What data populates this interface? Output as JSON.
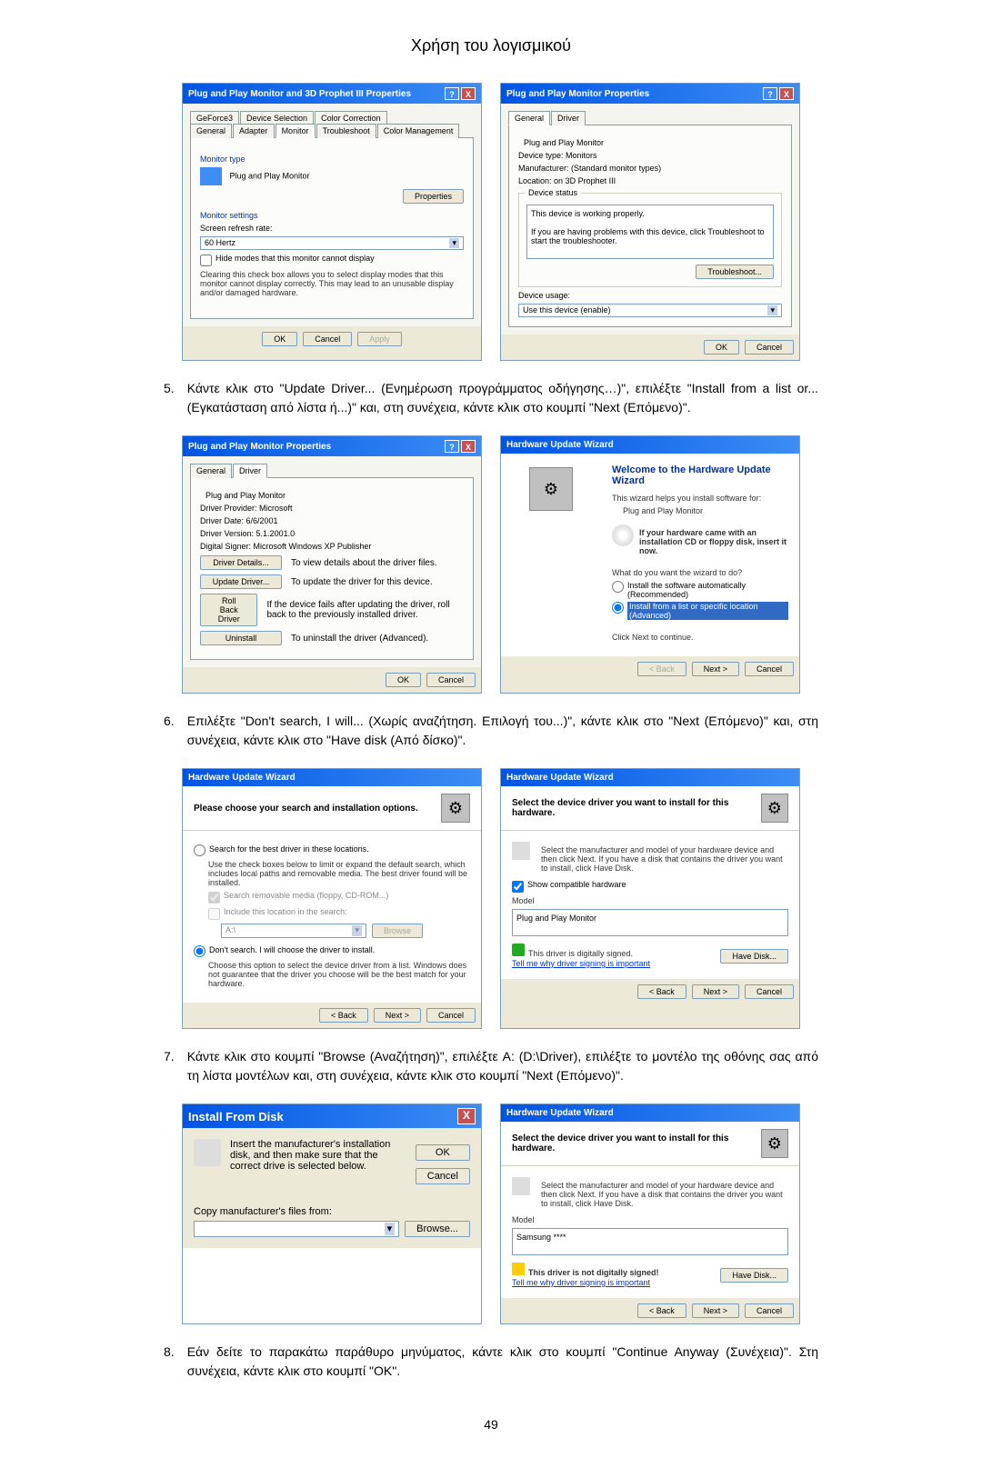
{
  "page_title": "Χρήση του λογισμικού",
  "page_number": "49",
  "steps": {
    "5": {
      "num": "5.",
      "text": "Κάντε κλικ στο \"Update Driver... (Ενημέρωση προγράμματος οδήγησης…)\", επιλέξτε \"Install from a list or...(Εγκατάσταση από λίστα ή...)\" και, στη συνέχεια, κάντε κλικ στο κουμπί \"Next (Επόμενο)\"."
    },
    "6": {
      "num": "6.",
      "text": "Επιλέξτε \"Don't search, I will... (Χωρίς αναζήτηση. Επιλογή του...)\", κάντε κλικ στο \"Next (Επόμενο)\" και, στη συνέχεια, κάντε κλικ στο \"Have disk (Από δίσκο)\"."
    },
    "7": {
      "num": "7.",
      "text": "Κάντε κλικ στο κουμπί \"Browse (Αναζήτηση)\", επιλέξτε A: (D:\\Driver), επιλέξτε το μοντέλο της οθόνης σας από τη λίστα μοντέλων και, στη συνέχεια, κάντε κλικ στο κουμπί \"Next (Επόμενο)\"."
    },
    "8": {
      "num": "8.",
      "text": "Εάν δείτε το παρακάτω παράθυρο μηνύματος, κάντε κλικ στο κουμπί \"Continue Anyway (Συνέχεια)\". Στη συνέχεια, κάντε κλικ στο κουμπί \"OK\"."
    }
  },
  "dlg1": {
    "title": "Plug and Play Monitor and 3D Prophet III Properties",
    "tabs": {
      "geforce": "GeForce3",
      "devsel": "Device Selection",
      "colorcorr": "Color Correction",
      "general": "General",
      "adapter": "Adapter",
      "monitor": "Monitor",
      "troubleshoot": "Troubleshoot",
      "colormgmt": "Color Management"
    },
    "monitor_type": "Monitor type",
    "pnp_monitor": "Plug and Play Monitor",
    "properties_btn": "Properties",
    "monitor_settings": "Monitor settings",
    "refresh_label": "Screen refresh rate:",
    "refresh_value": "60 Hertz",
    "hide_modes": "Hide modes that this monitor cannot display",
    "hide_modes_desc": "Clearing this check box allows you to select display modes that this monitor cannot display correctly. This may lead to an unusable display and/or damaged hardware.",
    "ok": "OK",
    "cancel": "Cancel",
    "apply": "Apply"
  },
  "dlg2": {
    "title": "Plug and Play Monitor Properties",
    "tabs": {
      "general": "General",
      "driver": "Driver"
    },
    "pnp_monitor": "Plug and Play Monitor",
    "device_type_label": "Device type:",
    "device_type": "Monitors",
    "manufacturer_label": "Manufacturer:",
    "manufacturer": "(Standard monitor types)",
    "location_label": "Location:",
    "location": "on 3D Prophet III",
    "device_status": "Device status",
    "status_text": "This device is working properly.",
    "status_help": "If you are having problems with this device, click Troubleshoot to start the troubleshooter.",
    "troubleshoot": "Troubleshoot...",
    "device_usage": "Device usage:",
    "usage_value": "Use this device (enable)",
    "ok": "OK",
    "cancel": "Cancel"
  },
  "dlg3": {
    "title": "Plug and Play Monitor Properties",
    "tabs": {
      "general": "General",
      "driver": "Driver"
    },
    "pnp_monitor": "Plug and Play Monitor",
    "provider_label": "Driver Provider:",
    "provider": "Microsoft",
    "date_label": "Driver Date:",
    "date": "6/6/2001",
    "version_label": "Driver Version:",
    "version": "5.1.2001.0",
    "signer_label": "Digital Signer:",
    "signer": "Microsoft Windows XP Publisher",
    "details_btn": "Driver Details...",
    "details_desc": "To view details about the driver files.",
    "update_btn": "Update Driver...",
    "update_desc": "To update the driver for this device.",
    "rollback_btn": "Roll Back Driver",
    "rollback_desc": "If the device fails after updating the driver, roll back to the previously installed driver.",
    "uninstall_btn": "Uninstall",
    "uninstall_desc": "To uninstall the driver (Advanced).",
    "ok": "OK",
    "cancel": "Cancel"
  },
  "dlg4": {
    "title": "Hardware Update Wizard",
    "heading": "Welcome to the Hardware Update Wizard",
    "intro": "This wizard helps you install software for:",
    "device": "Plug and Play Monitor",
    "cd_tip": "If your hardware came with an installation CD or floppy disk, insert it now.",
    "question": "What do you want the wizard to do?",
    "opt1": "Install the software automatically (Recommended)",
    "opt2": "Install from a list or specific location (Advanced)",
    "continue": "Click Next to continue.",
    "back": "< Back",
    "next": "Next >",
    "cancel": "Cancel"
  },
  "dlg5": {
    "title": "Hardware Update Wizard",
    "heading": "Please choose your search and installation options.",
    "opt1": "Search for the best driver in these locations.",
    "opt1_desc": "Use the check boxes below to limit or expand the default search, which includes local paths and removable media. The best driver found will be installed.",
    "chk1": "Search removable media (floppy, CD-ROM...)",
    "chk2": "Include this location in the search:",
    "location": "A:\\",
    "browse": "Browse",
    "opt2": "Don't search. I will choose the driver to install.",
    "opt2_desc": "Choose this option to select the device driver from a list. Windows does not guarantee that the driver you choose will be the best match for your hardware.",
    "back": "< Back",
    "next": "Next >",
    "cancel": "Cancel"
  },
  "dlg6": {
    "title": "Hardware Update Wizard",
    "heading": "Select the device driver you want to install for this hardware.",
    "instruction": "Select the manufacturer and model of your hardware device and then click Next. If you have a disk that contains the driver you want to install, click Have Disk.",
    "show_compat": "Show compatible hardware",
    "model_label": "Model",
    "model": "Plug and Play Monitor",
    "signed": "This driver is digitally signed.",
    "why_link": "Tell me why driver signing is important",
    "have_disk": "Have Disk...",
    "back": "< Back",
    "next": "Next >",
    "cancel": "Cancel"
  },
  "dlg7": {
    "title": "Install From Disk",
    "instruction": "Insert the manufacturer's installation disk, and then make sure that the correct drive is selected below.",
    "ok": "OK",
    "cancel": "Cancel",
    "copy_label": "Copy manufacturer's files from:",
    "path": "",
    "browse": "Browse..."
  },
  "dlg8": {
    "title": "Hardware Update Wizard",
    "heading": "Select the device driver you want to install for this hardware.",
    "instruction": "Select the manufacturer and model of your hardware device and then click Next. If you have a disk that contains the driver you want to install, click Have Disk.",
    "model_label": "Model",
    "model": "Samsung ****",
    "not_signed": "This driver is not digitally signed!",
    "why_link": "Tell me why driver signing is important",
    "have_disk": "Have Disk...",
    "back": "< Back",
    "next": "Next >",
    "cancel": "Cancel"
  }
}
